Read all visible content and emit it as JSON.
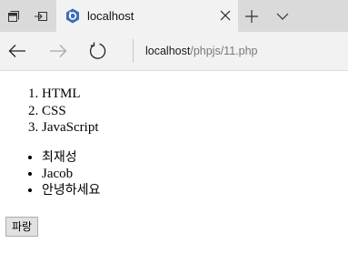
{
  "browser": {
    "tab": {
      "title": "localhost"
    },
    "address": {
      "host": "localhost",
      "path": "/phpjs/11.php"
    }
  },
  "page": {
    "ordered_list": [
      "HTML",
      "CSS",
      "JavaScript"
    ],
    "unordered_list": [
      "최재성",
      "Jacob",
      "안녕하세요"
    ],
    "button_label": "파랑"
  }
}
